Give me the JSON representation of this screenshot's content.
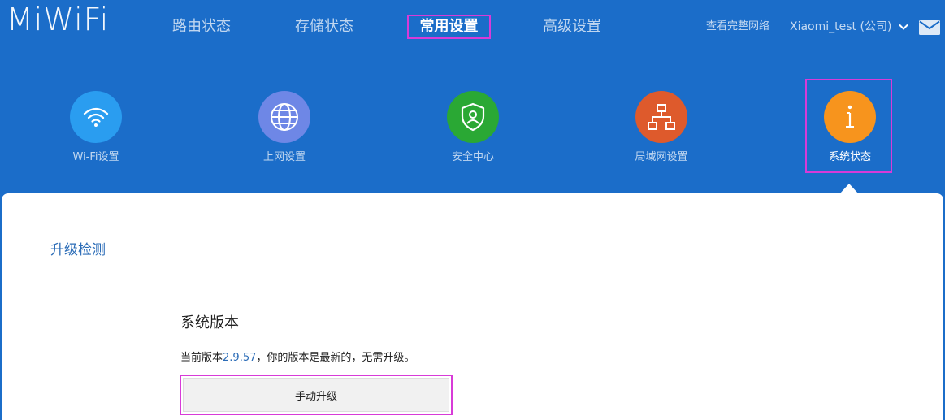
{
  "brand": {
    "logo_text": "MiWiFi"
  },
  "top_nav": {
    "items": [
      {
        "label": "路由状态"
      },
      {
        "label": "存储状态"
      },
      {
        "label": "常用设置"
      },
      {
        "label": "高级设置"
      }
    ],
    "active_index": 2
  },
  "header": {
    "view_network_label": "查看完整网络",
    "user_label": "Xiaomi_test (公司)"
  },
  "settings_menu": {
    "items": [
      {
        "label": "Wi-Fi设置",
        "icon": "wifi-icon",
        "color": "#2a9df0"
      },
      {
        "label": "上网设置",
        "icon": "globe-icon",
        "color": "#6e87e6"
      },
      {
        "label": "安全中心",
        "icon": "shield-icon",
        "color": "#2aa834"
      },
      {
        "label": "局域网设置",
        "icon": "network-icon",
        "color": "#de5a2c"
      },
      {
        "label": "系统状态",
        "icon": "info-icon",
        "color": "#f7941d"
      }
    ],
    "active_index": 4
  },
  "content": {
    "section_title": "升级检测",
    "version_heading": "系统版本",
    "version_prefix": "当前版本",
    "version_number": "2.9.57",
    "version_suffix": "，你的版本是最新的，无需升级。",
    "manual_upgrade_label": "手动升级"
  },
  "colors": {
    "background": "#1b6dc9",
    "highlight_border": "#d83bd8",
    "link_blue": "#2b6cb7"
  }
}
